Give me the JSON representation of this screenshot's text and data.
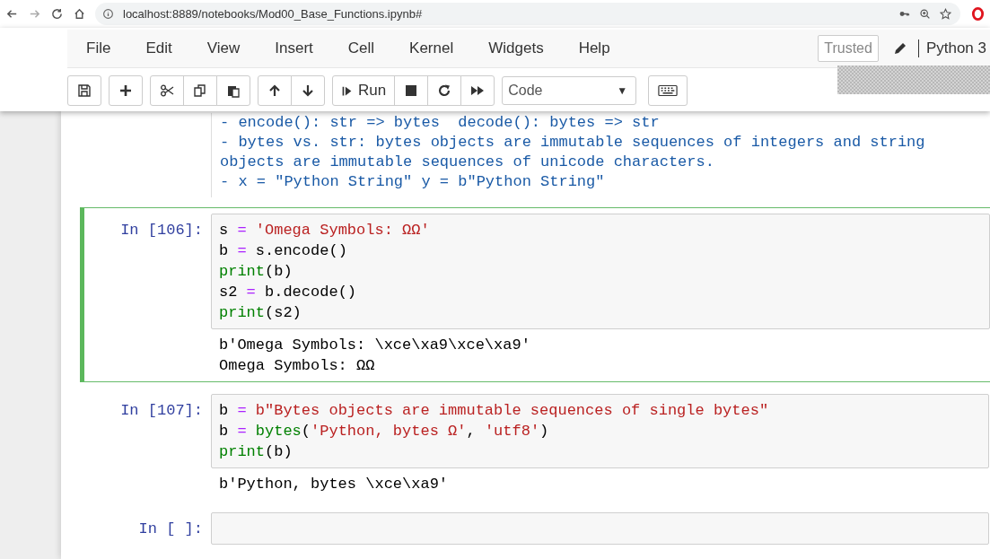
{
  "browser": {
    "url": "localhost:8889/notebooks/Mod00_Base_Functions.ipynb#"
  },
  "menu": [
    "File",
    "Edit",
    "View",
    "Insert",
    "Cell",
    "Kernel",
    "Widgets",
    "Help"
  ],
  "trusted": "Trusted",
  "kernel": "Python 3",
  "toolbar": {
    "run": "Run",
    "cell_type": "Code",
    "dropdown_arrow": "▼"
  },
  "cells": [
    {
      "kind": "markdown",
      "selected": false,
      "lines": [
        "- encode(): str => bytes  decode(): bytes => str",
        "- bytes vs. str: bytes objects are immutable sequences of integers and string",
        "objects are immutable sequences of unicode characters.",
        "- x = \"Python String\" y = b\"Python String\""
      ]
    },
    {
      "kind": "code",
      "selected": true,
      "prompt": "In [106]:",
      "code": [
        [
          {
            "t": "s",
            "kind": "plain"
          },
          {
            "t": " = ",
            "kind": "op"
          },
          {
            "t": "'Omega Symbols: ΩΩ'",
            "kind": "str"
          }
        ],
        [
          {
            "t": "b",
            "kind": "plain"
          },
          {
            "t": " = ",
            "kind": "op"
          },
          {
            "t": "s.encode()",
            "kind": "plain"
          }
        ],
        [
          {
            "t": "print",
            "kind": "builtin"
          },
          {
            "t": "(b)",
            "kind": "plain"
          }
        ],
        [
          {
            "t": "s2",
            "kind": "plain"
          },
          {
            "t": " = ",
            "kind": "op"
          },
          {
            "t": "b.decode()",
            "kind": "plain"
          }
        ],
        [
          {
            "t": "print",
            "kind": "builtin"
          },
          {
            "t": "(s2)",
            "kind": "plain"
          }
        ]
      ],
      "output": [
        "b'Omega Symbols: \\xce\\xa9\\xce\\xa9'",
        "Omega Symbols: ΩΩ"
      ]
    },
    {
      "kind": "code",
      "selected": false,
      "prompt": "In [107]:",
      "code": [
        [
          {
            "t": "b",
            "kind": "plain"
          },
          {
            "t": " = ",
            "kind": "op"
          },
          {
            "t": "b\"Bytes objects are immutable sequences of single bytes\"",
            "kind": "str"
          }
        ],
        [
          {
            "t": "b",
            "kind": "plain"
          },
          {
            "t": " = ",
            "kind": "op"
          },
          {
            "t": "bytes",
            "kind": "builtin"
          },
          {
            "t": "(",
            "kind": "plain"
          },
          {
            "t": "'Python, bytes Ω'",
            "kind": "str"
          },
          {
            "t": ", ",
            "kind": "plain"
          },
          {
            "t": "'utf8'",
            "kind": "str"
          },
          {
            "t": ")",
            "kind": "plain"
          }
        ],
        [
          {
            "t": "print",
            "kind": "builtin"
          },
          {
            "t": "(b)",
            "kind": "plain"
          }
        ]
      ],
      "output": [
        "b'Python, bytes \\xce\\xa9'"
      ]
    },
    {
      "kind": "code",
      "selected": false,
      "prompt": "In [ ]:"
    }
  ]
}
